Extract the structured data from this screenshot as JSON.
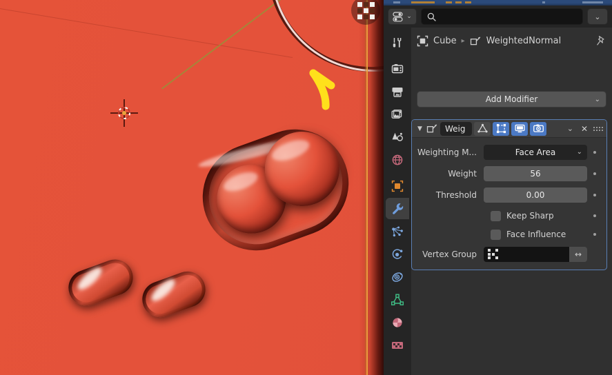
{
  "app": "Blender",
  "viewport": {
    "name": "3d-viewport",
    "background_color": "#e4523a",
    "selection_outline_color": "#e8a33d",
    "annotation": {
      "type": "arrow",
      "color": "#ffe01b",
      "direction": "up-right"
    },
    "cursor": "3d-cursor",
    "nav_gizmo": "view-grid-gizmo"
  },
  "properties_editor": {
    "header": {
      "filter_button": "filter-toggle",
      "search_placeholder": "",
      "search_value": "",
      "menu_button": "editor-menu"
    },
    "tabs": [
      {
        "id": "tool",
        "label": "Tool",
        "icon": "tool-icon",
        "active": false
      },
      {
        "id": "render",
        "label": "Render",
        "icon": "camera-back-icon",
        "active": false
      },
      {
        "id": "output",
        "label": "Output",
        "icon": "printer-icon",
        "active": false
      },
      {
        "id": "view_layer",
        "label": "View Layer",
        "icon": "images-icon",
        "active": false
      },
      {
        "id": "scene",
        "label": "Scene",
        "icon": "scene-cone-icon",
        "active": false
      },
      {
        "id": "world",
        "label": "World",
        "icon": "world-globe-icon",
        "active": false
      },
      {
        "id": "object",
        "label": "Object",
        "icon": "object-square-icon",
        "active": false
      },
      {
        "id": "modifiers",
        "label": "Modifiers",
        "icon": "wrench-icon",
        "active": true
      },
      {
        "id": "particles",
        "label": "Particles",
        "icon": "particles-icon",
        "active": false
      },
      {
        "id": "physics",
        "label": "Physics",
        "icon": "physics-orbit-icon",
        "active": false
      },
      {
        "id": "constraints",
        "label": "Object Constraints",
        "icon": "constraint-icon",
        "active": false
      },
      {
        "id": "data",
        "label": "Object Data",
        "icon": "mesh-data-icon",
        "active": false
      },
      {
        "id": "material",
        "label": "Material",
        "icon": "material-ball-icon",
        "active": false
      },
      {
        "id": "texture",
        "label": "Texture",
        "icon": "texture-checker-icon",
        "active": false
      }
    ],
    "breadcrumb": {
      "object_icon": "object-square-icon",
      "object_name": "Cube",
      "separator": "▸",
      "modifier_icon": "weighted-normal-icon",
      "modifier_name": "WeightedNormal",
      "pin_icon": "pin-icon"
    },
    "add_modifier": {
      "label": "Add Modifier",
      "chevron": "⌄"
    },
    "modifier": {
      "expand_icon": "▼",
      "type_icon": "weighted-normal-icon",
      "name": "Weig",
      "accent_color": "#4b79c4",
      "toggles": [
        {
          "id": "on_cage",
          "name": "edit-mode-cage-toggle",
          "icon": "triangle-mesh-icon",
          "enabled": false
        },
        {
          "id": "edit_mode",
          "name": "edit-mode-toggle",
          "icon": "edit-mode-icon",
          "enabled": true
        },
        {
          "id": "realtime",
          "name": "viewport-display-toggle",
          "icon": "display-monitor-icon",
          "enabled": true
        },
        {
          "id": "render",
          "name": "render-display-toggle",
          "icon": "camera-icon",
          "enabled": true
        }
      ],
      "extras_chevron": "⌄",
      "close_icon": "✕",
      "drag_handle": "drag-dots-handle",
      "fields": [
        {
          "label": "Weighting M...",
          "type": "dropdown",
          "value": "Face Area",
          "name": "weighting-mode-dropdown"
        },
        {
          "label": "Weight",
          "type": "number",
          "value": "56",
          "name": "weight-field"
        },
        {
          "label": "Threshold",
          "type": "number",
          "value": "0.00",
          "name": "threshold-field"
        }
      ],
      "checkboxes": [
        {
          "label": "Keep Sharp",
          "checked": false,
          "name": "keep-sharp-checkbox"
        },
        {
          "label": "Face Influence",
          "checked": false,
          "name": "face-influence-checkbox"
        }
      ],
      "vertex_group": {
        "label": "Vertex Group",
        "value": "",
        "icon": "vertex-group-icon",
        "invert_icon": "↔"
      }
    }
  }
}
